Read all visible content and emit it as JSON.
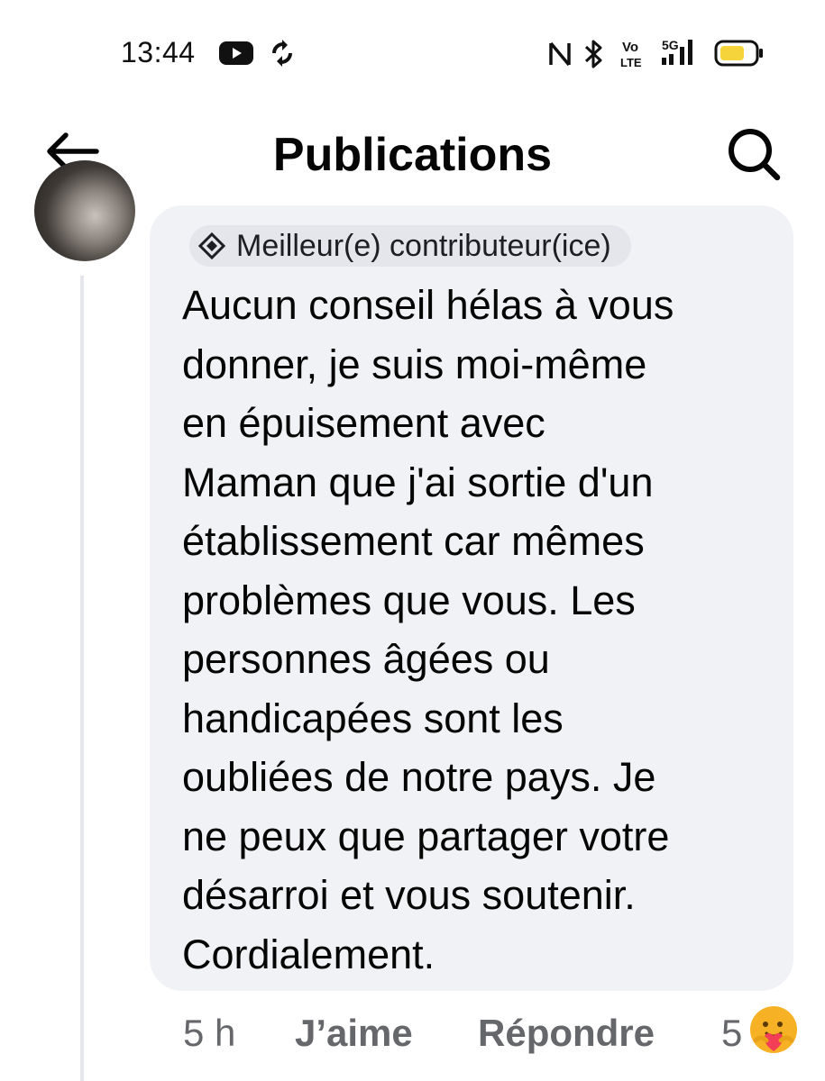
{
  "status_bar": {
    "time": "13:44",
    "icons": [
      "youtube-icon",
      "sync-icon",
      "nfc-icon",
      "bluetooth-icon",
      "volte-icon",
      "5g-signal-icon",
      "battery-icon"
    ],
    "battery_color": "#f5d33b"
  },
  "header": {
    "title": "Publications",
    "back_icon": "arrow-left-icon",
    "search_icon": "search-icon"
  },
  "comment": {
    "badge_label": "Meilleur(e) contributeur(ice)",
    "badge_icon": "diamond-badge-icon",
    "text_lines": [
      "Aucun conseil hélas à vous",
      "donner, je suis moi-même",
      "en épuisement avec",
      "Maman que j'ai sortie d'un",
      "établissement car mêmes",
      "problèmes que vous. Les",
      "personnes âgées ou",
      "handicapées sont les",
      "oubliées de notre pays. Je",
      "ne peux que partager votre",
      "désarroi et vous soutenir.",
      "Cordialement."
    ],
    "timestamp": "5 h",
    "like_label": "J’aime",
    "reply_label": "Répondre",
    "reaction_count": "5",
    "reaction_icon": "care-reaction-icon",
    "bubble_color": "#f0f2f5"
  }
}
